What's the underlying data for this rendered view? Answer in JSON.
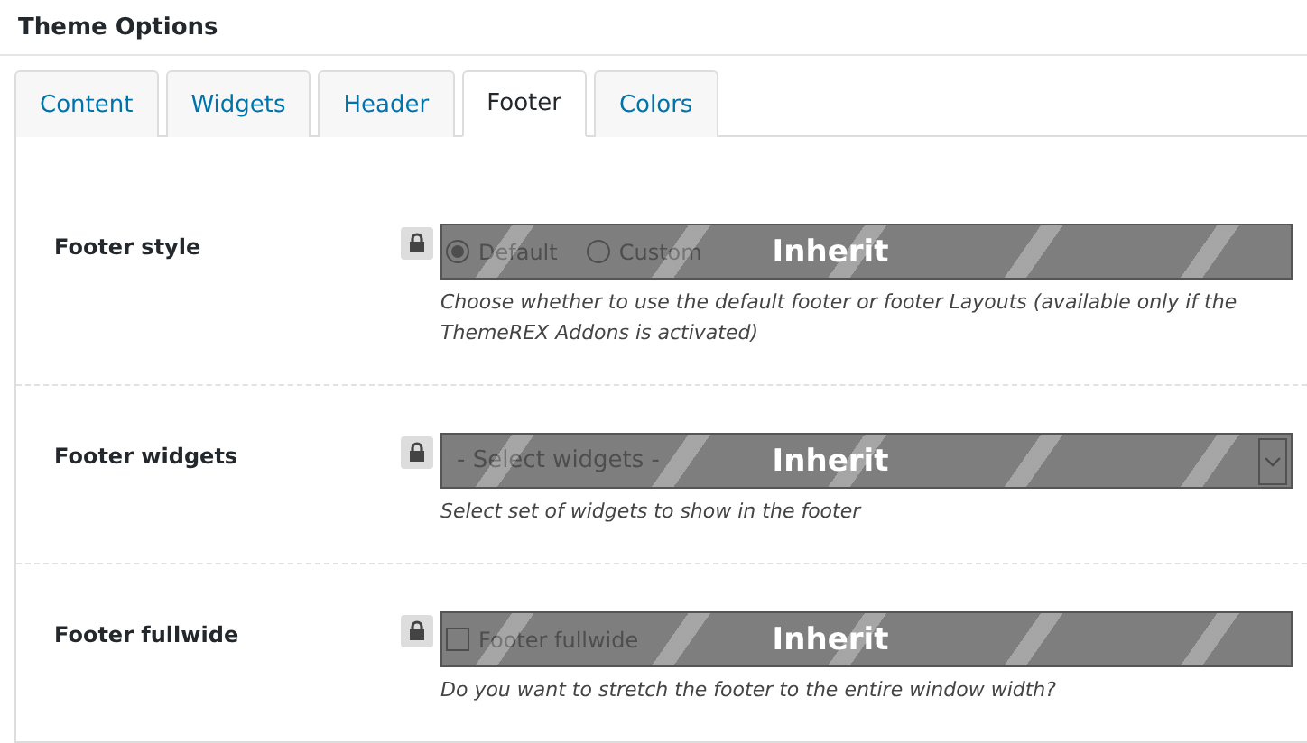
{
  "title": "Theme Options",
  "tabs": [
    {
      "label": "Content",
      "selected": false
    },
    {
      "label": "Widgets",
      "selected": false
    },
    {
      "label": "Header",
      "selected": false
    },
    {
      "label": "Footer",
      "selected": true
    },
    {
      "label": "Colors",
      "selected": false
    }
  ],
  "fields": [
    {
      "kind": "radio",
      "label": "Footer style",
      "options": [
        {
          "label": "Default",
          "selected": true
        },
        {
          "label": "Custom",
          "selected": false
        }
      ],
      "overlay": "Inherit",
      "description": "Choose whether to use the default footer or footer Layouts (available only if the ThemeREX Addons is activated)"
    },
    {
      "kind": "select",
      "label": "Footer widgets",
      "value": "- Select widgets -",
      "overlay": "Inherit",
      "description": "Select set of widgets to show in the footer"
    },
    {
      "kind": "checkbox",
      "label": "Footer fullwide",
      "text": "Footer fullwide",
      "checked": false,
      "overlay": "Inherit",
      "description": "Do you want to stretch the footer to the entire window width?"
    }
  ]
}
